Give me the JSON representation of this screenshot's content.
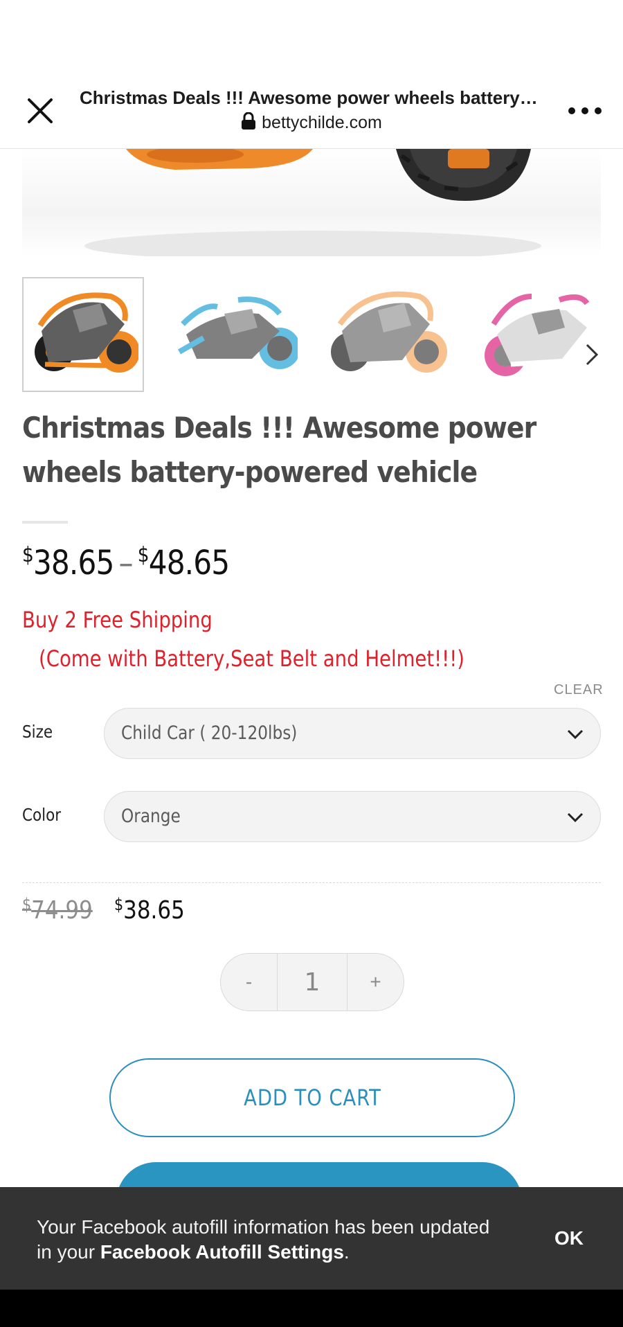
{
  "browser": {
    "title": "Christmas Deals !!! Awesome power wheels battery…",
    "url": "bettychilde.com",
    "icons": [
      "close-icon",
      "lock-icon",
      "more-icon"
    ]
  },
  "product": {
    "thumbnails": [
      {
        "name": "orange",
        "color": "#f08a24"
      },
      {
        "name": "blue",
        "color": "#49b3dc"
      },
      {
        "name": "orange-faded",
        "color": "#f4a862"
      },
      {
        "name": "pink",
        "color": "#e14a96"
      }
    ],
    "title": "Christmas Deals !!! Awesome power wheels battery-powered vehicle",
    "price_range": {
      "currency": "$",
      "low": "38.65",
      "separator": "–",
      "high": "48.65"
    },
    "promo_line1": "Buy 2 Free Shipping",
    "promo_line2": "(Come with Battery,Seat Belt and Helmet!!!)",
    "clear_label": "CLEAR",
    "variants": {
      "size": {
        "label": "Size",
        "value": "Child Car ( 20-120lbs)"
      },
      "color": {
        "label": "Color",
        "value": "Orange"
      }
    },
    "old_price": {
      "currency": "$",
      "value": "74.99"
    },
    "new_price": {
      "currency": "$",
      "value": "38.65"
    },
    "quantity": {
      "minus": "-",
      "value": "1",
      "plus": "+"
    },
    "add_to_cart": "ADD TO CART"
  },
  "snackbar": {
    "text_prefix": "Your Facebook autofill information has been updated in your ",
    "text_bold": "Facebook Autofill Settings",
    "text_suffix": ".",
    "ok_label": "OK"
  },
  "colors": {
    "accent": "#2b8fbd",
    "promo": "#e0202a",
    "snackbar_bg": "#333333"
  }
}
